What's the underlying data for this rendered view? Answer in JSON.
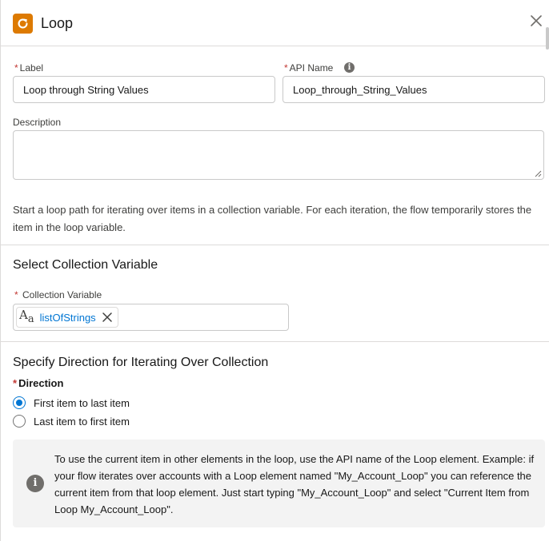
{
  "header": {
    "title": "Loop",
    "icon": "loop-icon",
    "close_icon": "close-icon"
  },
  "form": {
    "required_mark": "*",
    "label": {
      "text": "Label",
      "value": "Loop through String Values"
    },
    "api_name": {
      "text": "API Name",
      "value": "Loop_through_String_Values",
      "info_glyph": "i"
    },
    "description": {
      "text": "Description",
      "value": ""
    }
  },
  "help_text": "Start a loop path for iterating over items in a collection variable. For each iteration, the flow temporarily stores the item in the loop variable.",
  "collection_section": {
    "title": "Select Collection Variable",
    "field_label": "Collection Variable",
    "pill": {
      "type_glyph": "A",
      "type_sub": "a",
      "type_icon": "text-type-icon",
      "label": "listOfStrings",
      "remove_icon": "close-icon"
    }
  },
  "direction_section": {
    "title": "Specify Direction for Iterating Over Collection",
    "field_label": "Direction",
    "options": [
      {
        "label": "First item to last item",
        "checked": true
      },
      {
        "label": "Last item to first item",
        "checked": false
      }
    ]
  },
  "tip": {
    "icon_glyph": "i",
    "icon": "info-icon",
    "text": "To use the current item in other elements in the loop, use the API name of the Loop element. Example: if your flow iterates over accounts with a Loop element named \"My_Account_Loop\" you can reference the current item from that loop element. Just start typing \"My_Account_Loop\" and select \"Current Item from Loop My_Account_Loop\"."
  },
  "colors": {
    "accent": "#0176d3",
    "loop_icon_bg": "#dd7a01",
    "required": "#c23934",
    "tip_bg": "#f3f3f3"
  }
}
